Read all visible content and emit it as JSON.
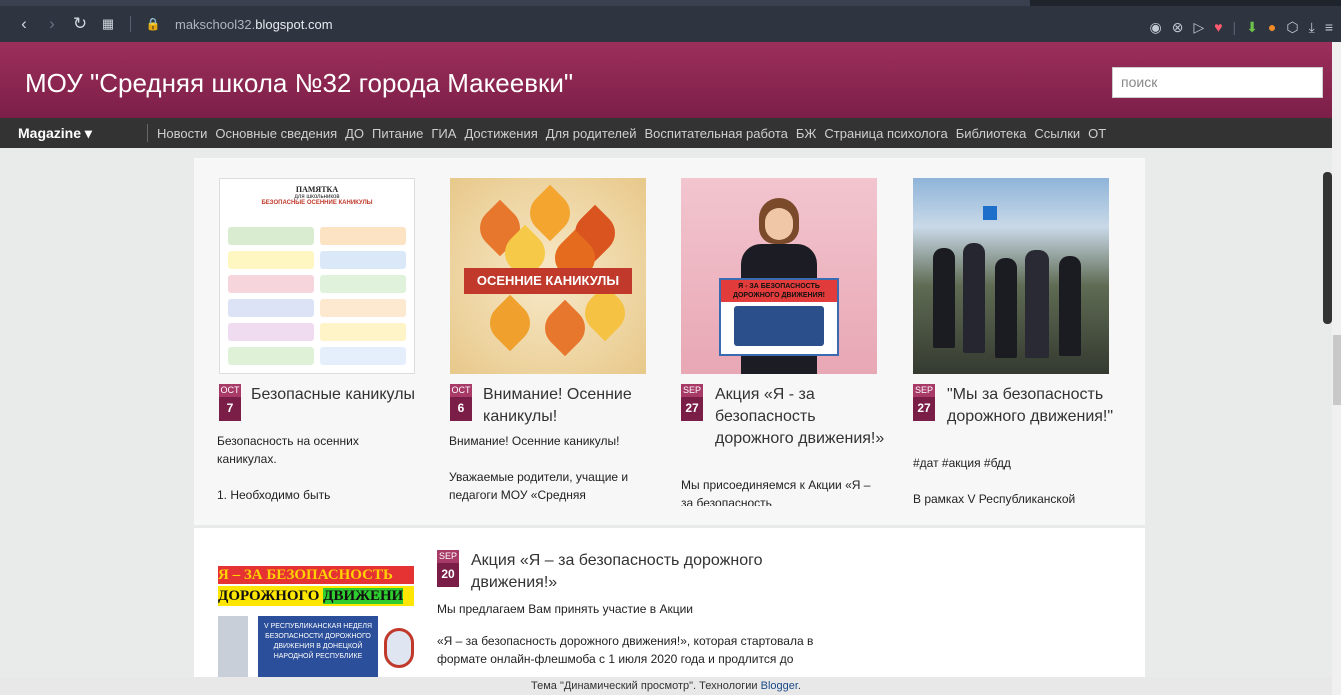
{
  "browser": {
    "url_prefix": "makschool32.",
    "url_domain": "blogspot.com"
  },
  "site": {
    "title": "МОУ \"Средняя школа №32 города Макеевки\"",
    "search_placeholder": "поиск"
  },
  "nav": {
    "view_label": "Magazine ▾",
    "links": [
      "Новости",
      "Основные сведения",
      "ДО",
      "Питание",
      "ГИА",
      "Достижения",
      "Для родителей",
      "Воспитательная работа",
      "БЖ",
      "Страница психолога",
      "Библиотека",
      "Ссылки",
      "ОТ"
    ]
  },
  "posts": [
    {
      "month": "OCT",
      "day": "7",
      "title": "Безопасные каникулы",
      "text": "Безопасность на осенних каникулах.\n\n1. Необходимо быть",
      "image_title": "ПАМЯТКА",
      "image_sub1": "для школьников",
      "image_sub2": "БЕЗОПАСНЫЕ ОСЕННИЕ КАНИКУЛЫ"
    },
    {
      "month": "OCT",
      "day": "6",
      "title": "Внимание! Осенние каникулы!",
      "text": "Внимание! Осенние каникулы!\n\nУважаемые родители, учащие и педагоги МОУ «Средняя",
      "image_title": "ОСЕННИЕ КАНИКУЛЫ"
    },
    {
      "month": "SEP",
      "day": "27",
      "title": "Акция «Я - за безопасность дорожного движения!»",
      "text": "Мы присоединяемся к Акции «Я – за безопасность",
      "image_title": "Я - ЗА БЕЗОПАСНОСТЬ ДОРОЖНОГО ДВИЖЕНИЯ!"
    },
    {
      "month": "SEP",
      "day": "27",
      "title": "\"Мы за безопасность дорожного движения!\"",
      "text": "#дат #акция #бдд\n\nВ рамках V Республиканской"
    }
  ],
  "featured": {
    "month": "SEP",
    "day": "20",
    "title": "Акция «Я – за безопасность дорожного движения!»",
    "text1": "Мы предлагаем Вам принять участие в Акции",
    "text2": "«Я – за безопасность дорожного движения!», которая стартовала в формате онлайн-флешмоба с 1 июля 2020 года и продлится до",
    "image_line1": "Я – ЗА БЕЗОПАСНОСТЬ",
    "image_line2a": "ДОРОЖНОГО ",
    "image_line2b": "ДВИЖЕНИ",
    "image_box": "V РЕСПУБЛИКАНСКАЯ НЕДЕЛЯ БЕЗОПАСНОСТИ ДОРОЖНОГО ДВИЖЕНИЯ В ДОНЕЦКОЙ НАРОДНОЙ РЕСПУБЛИКЕ"
  },
  "footer": {
    "text": "Тема \"Динамический просмотр\". Технологии ",
    "link": "Blogger",
    "end": "."
  },
  "colors": {
    "header": "#8c2852",
    "navbar": "#333333",
    "badge": "#7a1e47"
  }
}
